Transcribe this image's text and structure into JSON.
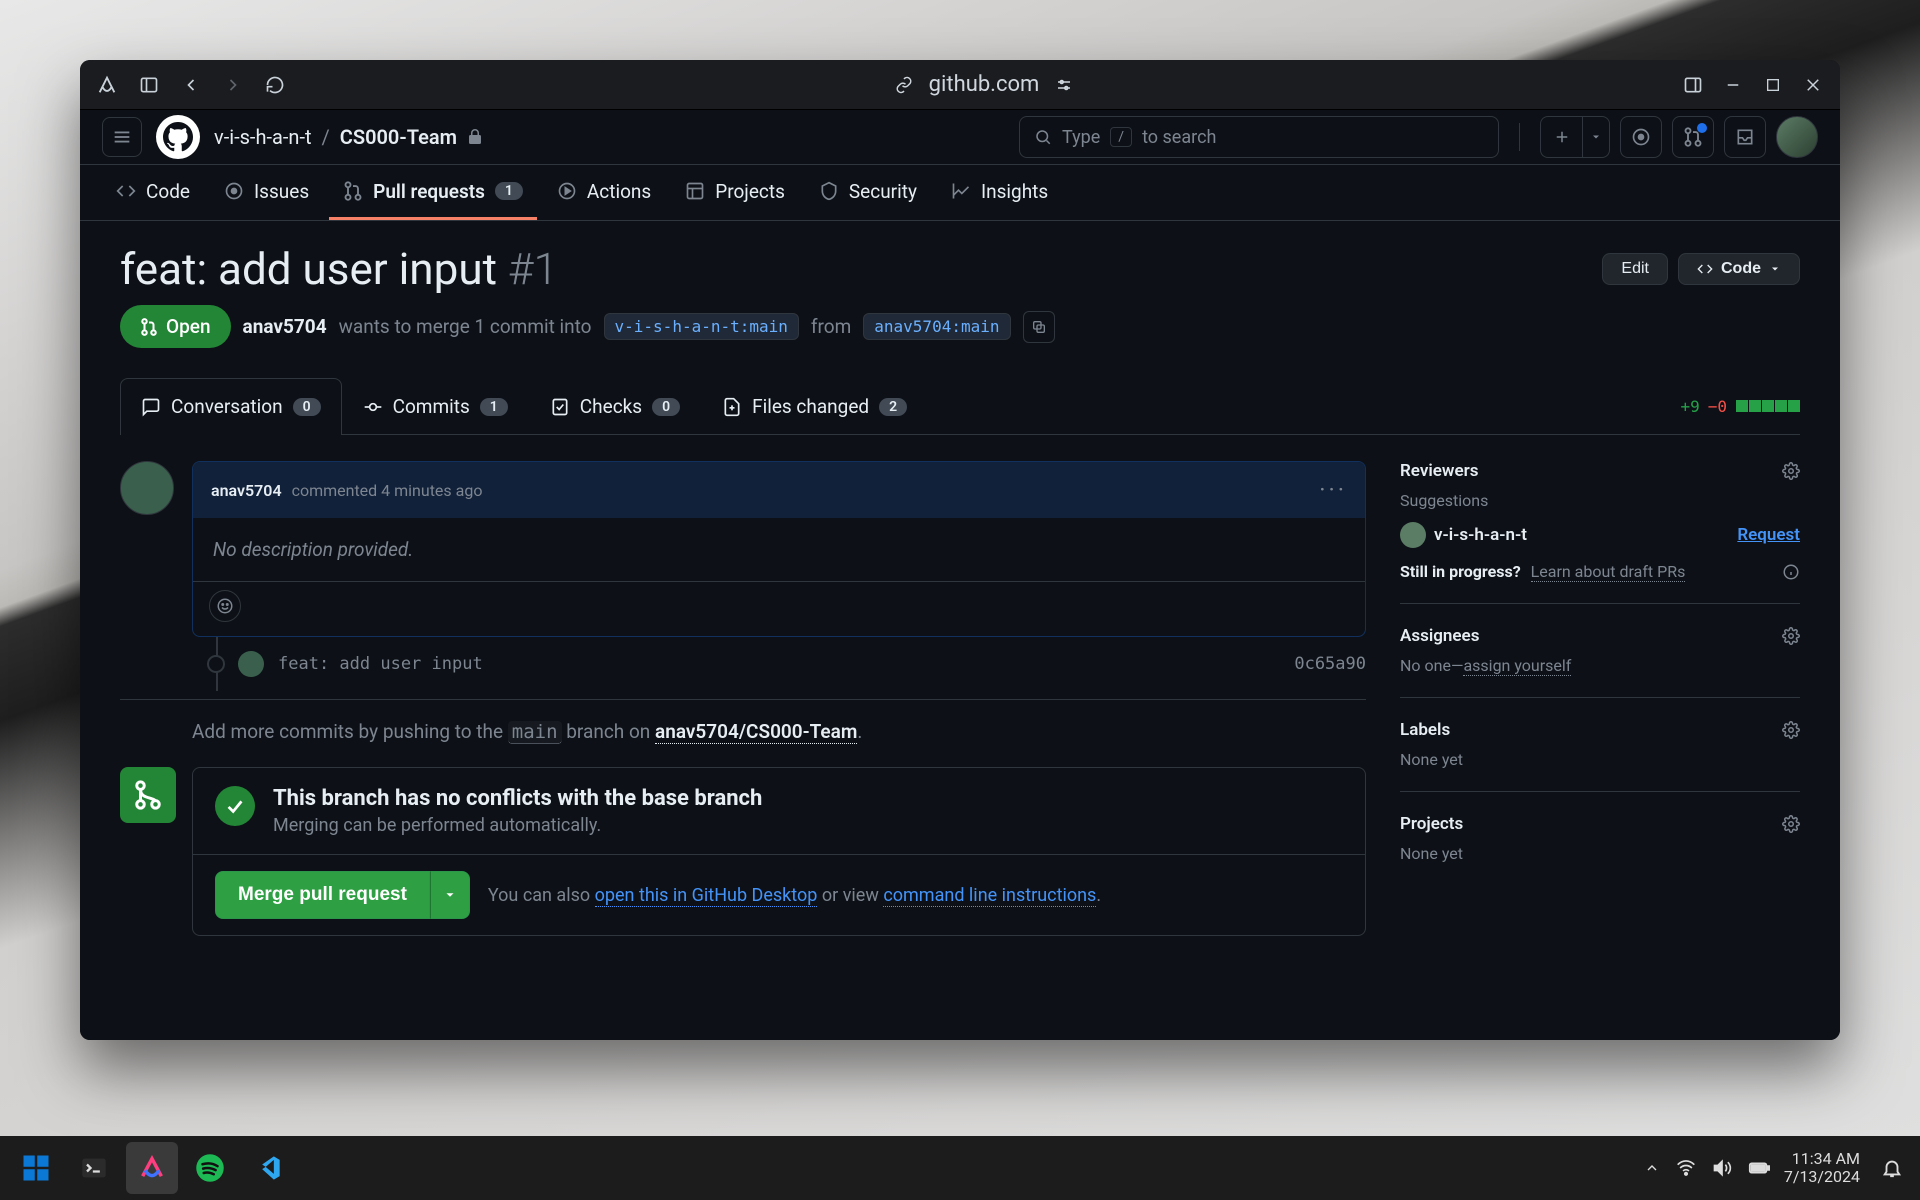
{
  "browser": {
    "domain": "github.com"
  },
  "repo": {
    "owner": "v-i-s-h-a-n-t",
    "name": "CS000-Team"
  },
  "search": {
    "prefix": "Type",
    "key": "/",
    "suffix": "to search"
  },
  "nav": {
    "code": "Code",
    "issues": "Issues",
    "pulls": "Pull requests",
    "pulls_count": "1",
    "actions": "Actions",
    "projects": "Projects",
    "security": "Security",
    "insights": "Insights"
  },
  "pr": {
    "title": "feat: add user input",
    "number": "#1",
    "edit": "Edit",
    "code": "Code",
    "status": "Open",
    "author": "anav5704",
    "merge_text1": "wants to merge 1 commit into",
    "base_branch": "v-i-s-h-a-n-t:main",
    "merge_text2": "from",
    "head_branch": "anav5704:main"
  },
  "pr_tabs": {
    "conversation": "Conversation",
    "conversation_count": "0",
    "commits": "Commits",
    "commits_count": "1",
    "checks": "Checks",
    "checks_count": "0",
    "files": "Files changed",
    "files_count": "2",
    "additions": "+9",
    "deletions": "−0"
  },
  "comment": {
    "author": "anav5704",
    "meta": "commented 4 minutes ago",
    "body": "No description provided."
  },
  "commit": {
    "message": "feat: add user input",
    "sha": "0c65a90"
  },
  "hint": {
    "prefix": "Add more commits by pushing to the",
    "branch": "main",
    "mid": "branch on",
    "repo": "anav5704/CS000-Team"
  },
  "merge": {
    "headline": "This branch has no conflicts with the base branch",
    "sub": "Merging can be performed automatically.",
    "button": "Merge pull request",
    "you_can_also": "You can also",
    "desktop": "open this in GitHub Desktop",
    "or_view": "or view",
    "cli": "command line instructions"
  },
  "sidebar": {
    "reviewers": {
      "title": "Reviewers",
      "suggestions": "Suggestions",
      "user": "v-i-s-h-a-n-t",
      "request": "Request",
      "draft_q": "Still in progress?",
      "draft_link": "Learn about draft PRs"
    },
    "assignees": {
      "title": "Assignees",
      "text": "No one—",
      "link": "assign yourself"
    },
    "labels": {
      "title": "Labels",
      "text": "None yet"
    },
    "projects": {
      "title": "Projects",
      "text": "None yet"
    }
  },
  "taskbar": {
    "time": "11:34 AM",
    "date": "7/13/2024"
  }
}
